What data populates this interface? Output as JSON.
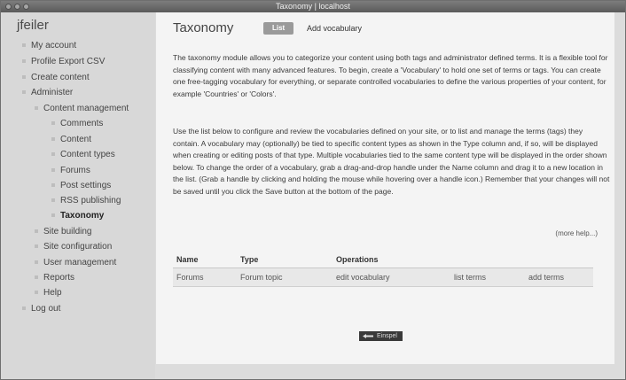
{
  "window": {
    "title": "Taxonomy | localhost"
  },
  "site": {
    "name": "jfeiler"
  },
  "sidebar": {
    "items": [
      {
        "label": "My account"
      },
      {
        "label": "Profile Export CSV"
      },
      {
        "label": "Create content"
      },
      {
        "label": "Administer"
      },
      {
        "label": "Content management"
      },
      {
        "label": "Comments"
      },
      {
        "label": "Content"
      },
      {
        "label": "Content types"
      },
      {
        "label": "Forums"
      },
      {
        "label": "Post settings"
      },
      {
        "label": "RSS publishing"
      },
      {
        "label": "Taxonomy"
      },
      {
        "label": "Site building"
      },
      {
        "label": "Site configuration"
      },
      {
        "label": "User management"
      },
      {
        "label": "Reports"
      },
      {
        "label": "Help"
      },
      {
        "label": "Log out"
      }
    ]
  },
  "main": {
    "title": "Taxonomy",
    "tabs": [
      {
        "label": "List"
      },
      {
        "label": "Add vocabulary"
      }
    ],
    "intro": "The taxonomy module allows you to categorize your content using both tags and administrator defined terms. It is a flexible tool for classifying content with many advanced features. To begin, create a 'Vocabulary' to hold one set of terms or tags. You can create one free-tagging vocabulary for everything, or separate controlled vocabularies to define the various properties of your content, for example 'Countries' or 'Colors'.",
    "instructions": "Use the list below to configure and review the vocabularies defined on your site, or to list and manage the terms (tags) they contain. A vocabulary may (optionally) be tied to specific content types as shown in the Type column and, if so, will be displayed when creating or editing posts of that type. Multiple vocabularies tied to the same content type will be displayed in the order shown below. To change the order of a vocabulary, grab a drag-and-drop handle under the Name column and drag it to a new location in the list. (Grab a handle by clicking and holding the mouse while hovering over a handle icon.) Remember that your changes will not be saved until you click the Save button at the bottom of the page.",
    "more_help": "(more help...)",
    "table": {
      "headers": {
        "name": "Name",
        "type": "Type",
        "operations": "Operations"
      },
      "rows": [
        {
          "name": "Forums",
          "type": "Forum topic",
          "edit": "edit vocabulary",
          "list": "list terms",
          "add": "add terms"
        }
      ]
    },
    "save_label": "Einspel"
  }
}
